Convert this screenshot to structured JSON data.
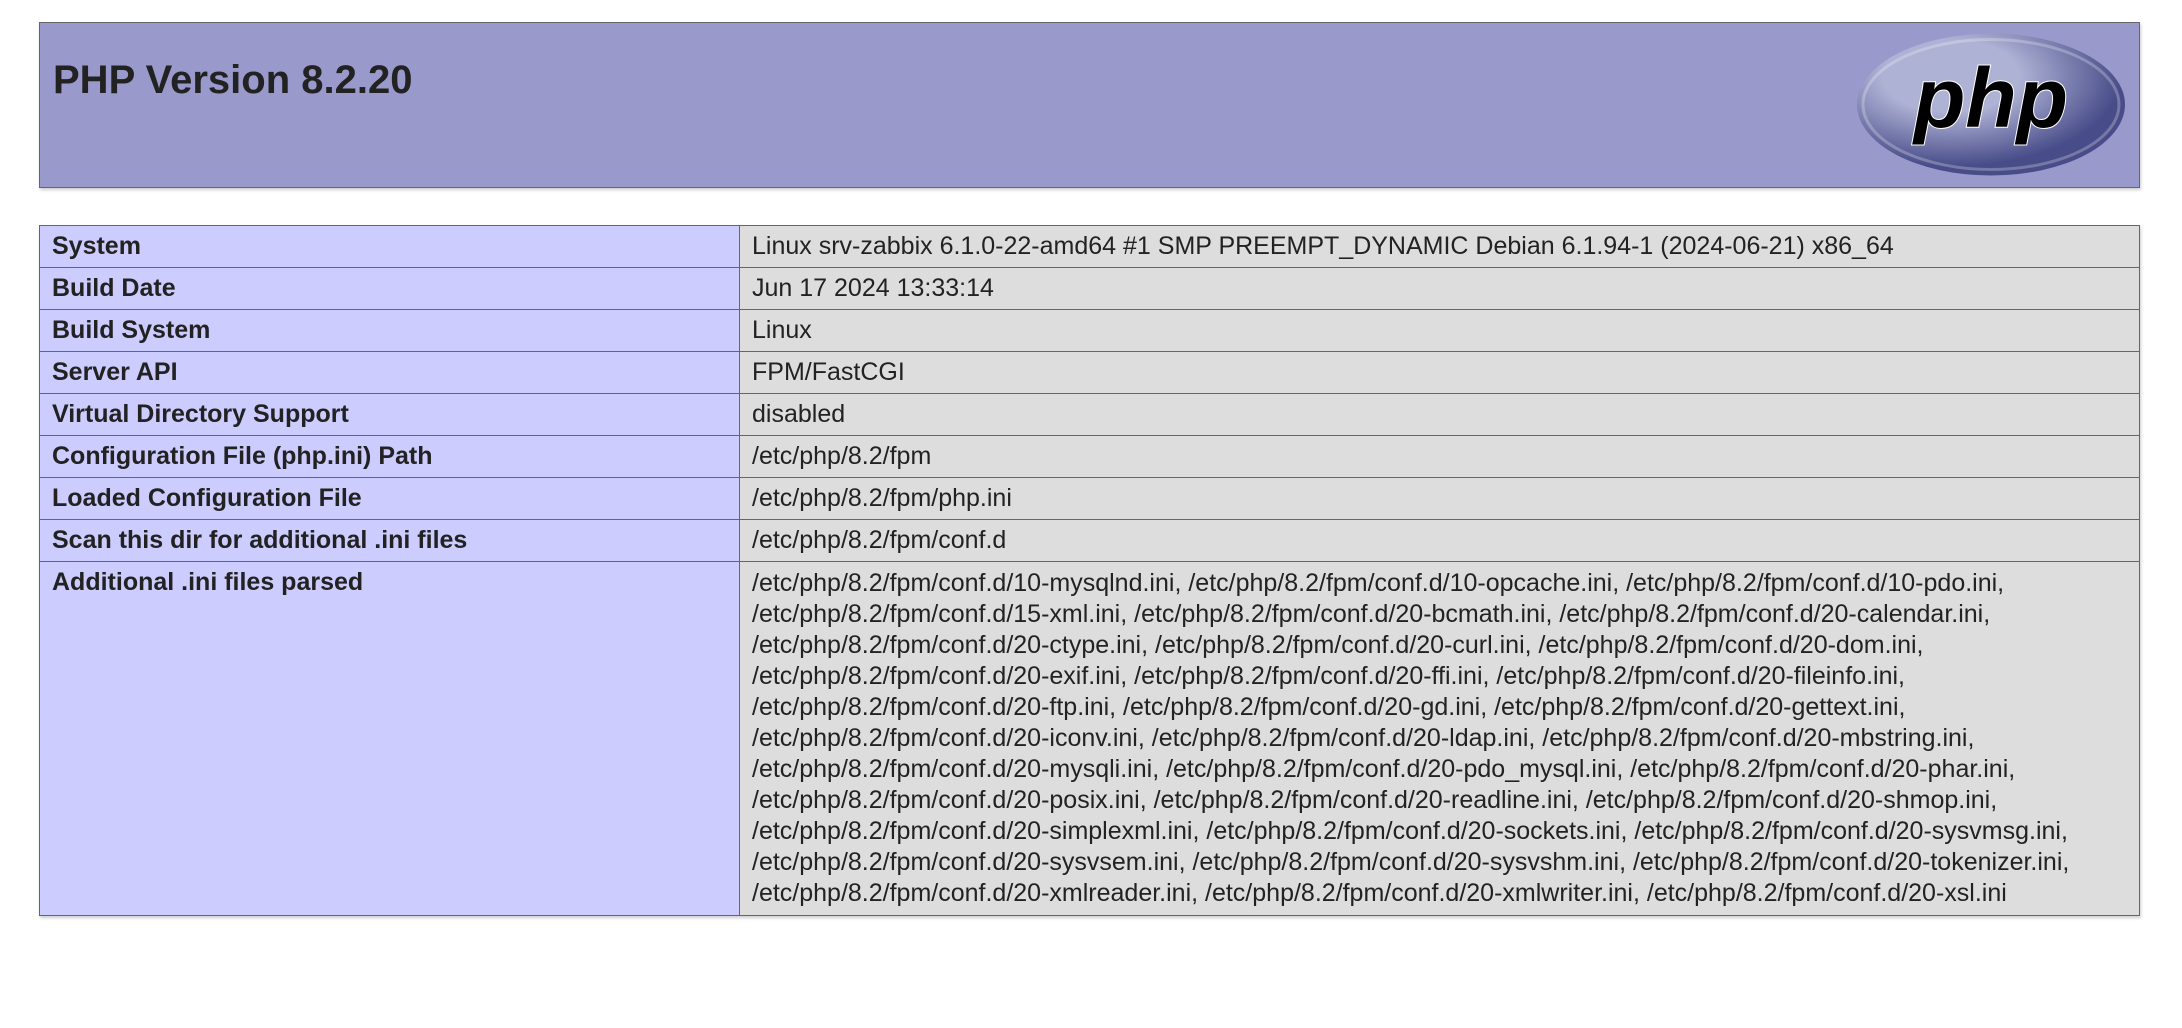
{
  "header": {
    "title": "PHP Version 8.2.20",
    "logo_icon": "php-logo-icon",
    "logo_text": "php"
  },
  "colors": {
    "header_bg": "#9999cc",
    "label_bg": "#ccccff",
    "value_bg": "#dddddd"
  },
  "rows": [
    {
      "label": "System",
      "value": "Linux srv-zabbix 6.1.0-22-amd64 #1 SMP PREEMPT_DYNAMIC Debian 6.1.94-1 (2024-06-21) x86_64"
    },
    {
      "label": "Build Date",
      "value": "Jun 17 2024 13:33:14"
    },
    {
      "label": "Build System",
      "value": "Linux"
    },
    {
      "label": "Server API",
      "value": "FPM/FastCGI"
    },
    {
      "label": "Virtual Directory Support",
      "value": "disabled"
    },
    {
      "label": "Configuration File (php.ini) Path",
      "value": "/etc/php/8.2/fpm"
    },
    {
      "label": "Loaded Configuration File",
      "value": "/etc/php/8.2/fpm/php.ini"
    },
    {
      "label": "Scan this dir for additional .ini files",
      "value": "/etc/php/8.2/fpm/conf.d"
    },
    {
      "label": "Additional .ini files parsed",
      "value": "/etc/php/8.2/fpm/conf.d/10-mysqlnd.ini, /etc/php/8.2/fpm/conf.d/10-opcache.ini, /etc/php/8.2/fpm/conf.d/10-pdo.ini, /etc/php/8.2/fpm/conf.d/15-xml.ini, /etc/php/8.2/fpm/conf.d/20-bcmath.ini, /etc/php/8.2/fpm/conf.d/20-calendar.ini, /etc/php/8.2/fpm/conf.d/20-ctype.ini, /etc/php/8.2/fpm/conf.d/20-curl.ini, /etc/php/8.2/fpm/conf.d/20-dom.ini, /etc/php/8.2/fpm/conf.d/20-exif.ini, /etc/php/8.2/fpm/conf.d/20-ffi.ini, /etc/php/8.2/fpm/conf.d/20-fileinfo.ini, /etc/php/8.2/fpm/conf.d/20-ftp.ini, /etc/php/8.2/fpm/conf.d/20-gd.ini, /etc/php/8.2/fpm/conf.d/20-gettext.ini, /etc/php/8.2/fpm/conf.d/20-iconv.ini, /etc/php/8.2/fpm/conf.d/20-ldap.ini, /etc/php/8.2/fpm/conf.d/20-mbstring.ini, /etc/php/8.2/fpm/conf.d/20-mysqli.ini, /etc/php/8.2/fpm/conf.d/20-pdo_mysql.ini, /etc/php/8.2/fpm/conf.d/20-phar.ini, /etc/php/8.2/fpm/conf.d/20-posix.ini, /etc/php/8.2/fpm/conf.d/20-readline.ini, /etc/php/8.2/fpm/conf.d/20-shmop.ini, /etc/php/8.2/fpm/conf.d/20-simplexml.ini, /etc/php/8.2/fpm/conf.d/20-sockets.ini, /etc/php/8.2/fpm/conf.d/20-sysvmsg.ini, /etc/php/8.2/fpm/conf.d/20-sysvsem.ini, /etc/php/8.2/fpm/conf.d/20-sysvshm.ini, /etc/php/8.2/fpm/conf.d/20-tokenizer.ini, /etc/php/8.2/fpm/conf.d/20-xmlreader.ini, /etc/php/8.2/fpm/conf.d/20-xmlwriter.ini, /etc/php/8.2/fpm/conf.d/20-xsl.ini"
    }
  ]
}
